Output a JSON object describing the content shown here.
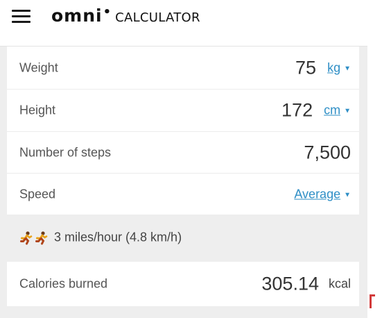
{
  "header": {
    "logo_omni": "omni",
    "logo_dot": "•",
    "logo_calculator": "CALCULATOR"
  },
  "fields": {
    "weight": {
      "label": "Weight",
      "value": "75",
      "unit": "kg"
    },
    "height": {
      "label": "Height",
      "value": "172",
      "unit": "cm"
    },
    "steps": {
      "label": "Number of steps",
      "value": "7,500"
    },
    "speed": {
      "label": "Speed",
      "selected": "Average"
    }
  },
  "speed_info": {
    "text": "3 miles/hour (4.8 km/h)",
    "icons": [
      "runner-icon",
      "runner-icon"
    ]
  },
  "result": {
    "label": "Calories burned",
    "value": "305.14",
    "unit": "kcal"
  },
  "colors": {
    "link": "#2f8fc6",
    "panel_bg": "#eeeeee",
    "runner": "#e8a21a"
  },
  "icons": {
    "menu": "hamburger-menu-icon",
    "dropdown": "caret-down-icon",
    "runner": "runner-icon"
  }
}
